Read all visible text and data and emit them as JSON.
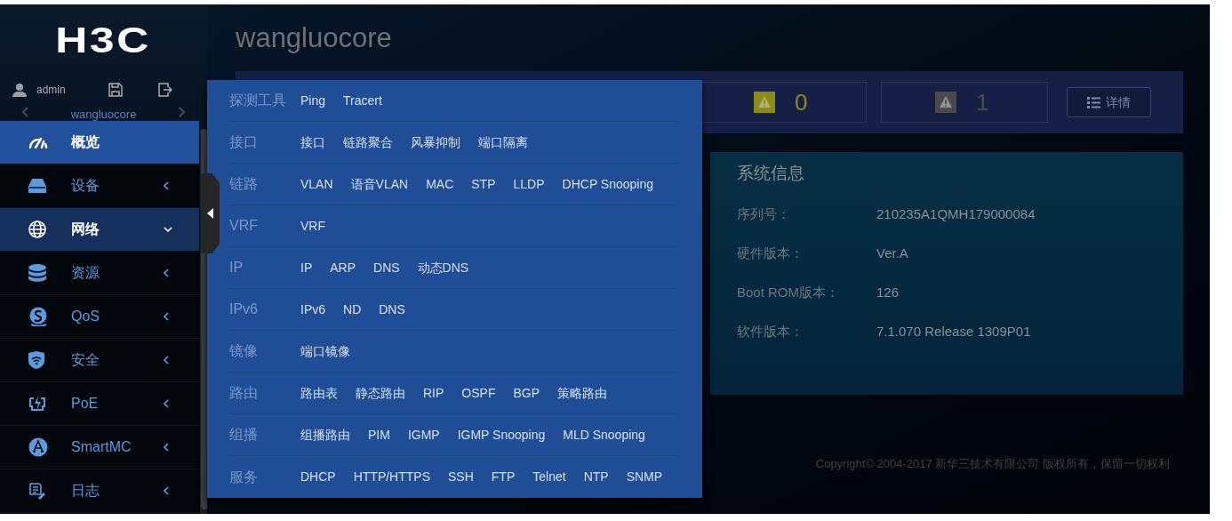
{
  "logo": "H3C",
  "user": {
    "name": "admin"
  },
  "device_switcher": {
    "name": "wangluocore"
  },
  "nav": [
    {
      "label": "概览",
      "selected": true,
      "expanded": false,
      "has_children": false
    },
    {
      "label": "设备",
      "selected": false,
      "expanded": false,
      "has_children": true
    },
    {
      "label": "网络",
      "selected": false,
      "expanded": true,
      "has_children": true
    },
    {
      "label": "资源",
      "selected": false,
      "expanded": false,
      "has_children": true
    },
    {
      "label": "QoS",
      "selected": false,
      "expanded": false,
      "has_children": true
    },
    {
      "label": "安全",
      "selected": false,
      "expanded": false,
      "has_children": true
    },
    {
      "label": "PoE",
      "selected": false,
      "expanded": false,
      "has_children": true
    },
    {
      "label": "SmartMC",
      "selected": false,
      "expanded": false,
      "has_children": true
    },
    {
      "label": "日志",
      "selected": false,
      "expanded": false,
      "has_children": true
    }
  ],
  "page_title": "wangluocore",
  "alarms": [
    {
      "color": "#8c8c12",
      "count": "0"
    },
    {
      "color": "#4a4a4a",
      "count": "1"
    }
  ],
  "details_button": "详情",
  "system_info": {
    "title": "系统信息",
    "rows": [
      {
        "label": "序列号：",
        "value": "210235A1QMH179000084"
      },
      {
        "label": "硬件版本：",
        "value": "Ver.A"
      },
      {
        "label": "Boot ROM版本：",
        "value": "126"
      },
      {
        "label": "软件版本：",
        "value": "7.1.070 Release 1309P01"
      }
    ]
  },
  "copyright": "Copyright© 2004-2017 新华三技术有限公司 版权所有，保留一切权利",
  "network_menu": [
    {
      "category": "探测工具",
      "items": [
        "Ping",
        "Tracert"
      ]
    },
    {
      "category": "接口",
      "items": [
        "接口",
        "链路聚合",
        "风暴抑制",
        "端口隔离"
      ]
    },
    {
      "category": "链路",
      "items": [
        "VLAN",
        "语音VLAN",
        "MAC",
        "STP",
        "LLDP",
        "DHCP Snooping"
      ]
    },
    {
      "category": "VRF",
      "items": [
        "VRF"
      ]
    },
    {
      "category": "IP",
      "items": [
        "IP",
        "ARP",
        "DNS",
        "动态DNS"
      ]
    },
    {
      "category": "IPv6",
      "items": [
        "IPv6",
        "ND",
        "DNS"
      ]
    },
    {
      "category": "镜像",
      "items": [
        "端口镜像"
      ]
    },
    {
      "category": "路由",
      "items": [
        "路由表",
        "静态路由",
        "RIP",
        "OSPF",
        "BGP",
        "策略路由"
      ]
    },
    {
      "category": "组播",
      "items": [
        "组播路由",
        "PIM",
        "IGMP",
        "IGMP Snooping",
        "MLD Snooping"
      ]
    },
    {
      "category": "服务",
      "items": [
        "DHCP",
        "HTTP/HTTPS",
        "SSH",
        "FTP",
        "Telnet",
        "NTP",
        "SNMP"
      ]
    }
  ]
}
